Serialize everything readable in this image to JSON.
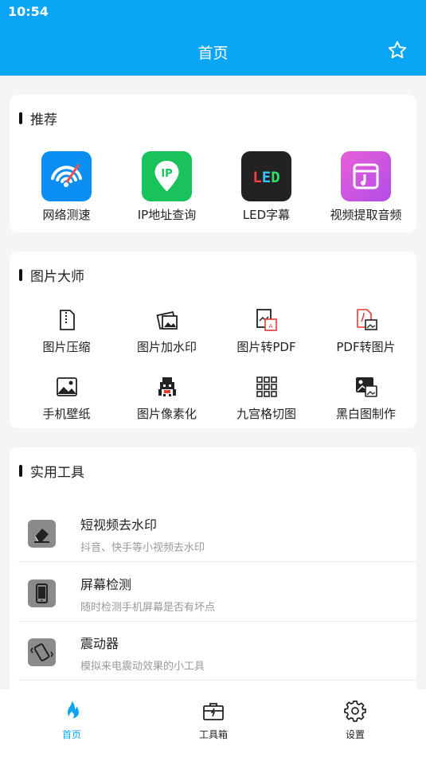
{
  "status": {
    "time": "10:54"
  },
  "header": {
    "title": "首页"
  },
  "recommend": {
    "title": "推荐",
    "items": [
      {
        "label": "网络测速",
        "icon": "speedometer-icon"
      },
      {
        "label": "IP地址查询",
        "icon": "ip-location-icon"
      },
      {
        "label": "LED字幕",
        "icon": "led-icon",
        "icon_text": "LED"
      },
      {
        "label": "视频提取音频",
        "icon": "video-audio-icon"
      }
    ]
  },
  "picture": {
    "title": "图片大师",
    "items": [
      {
        "label": "图片压缩",
        "icon": "zip-file-icon"
      },
      {
        "label": "图片加水印",
        "icon": "watermark-icon"
      },
      {
        "label": "图片转PDF",
        "icon": "image-to-pdf-icon"
      },
      {
        "label": "PDF转图片",
        "icon": "pdf-to-image-icon"
      },
      {
        "label": "手机壁纸",
        "icon": "wallpaper-icon"
      },
      {
        "label": "图片像素化",
        "icon": "pixelate-icon"
      },
      {
        "label": "九宫格切图",
        "icon": "grid-icon"
      },
      {
        "label": "黑白图制作",
        "icon": "black-white-icon"
      }
    ]
  },
  "tools": {
    "title": "实用工具",
    "items": [
      {
        "title": "短视频去水印",
        "desc": "抖音、快手等小视频去水印",
        "icon": "eraser-icon"
      },
      {
        "title": "屏幕检测",
        "desc": "随时检测手机屏幕是否有坏点",
        "icon": "phone-icon"
      },
      {
        "title": "震动器",
        "desc": "模拟来电震动效果的小工具",
        "icon": "vibrate-icon"
      }
    ]
  },
  "nav": {
    "items": [
      {
        "label": "首页",
        "icon": "fire-icon",
        "active": true
      },
      {
        "label": "工具箱",
        "icon": "toolbox-icon",
        "active": false
      },
      {
        "label": "设置",
        "icon": "gear-icon",
        "active": false
      }
    ]
  },
  "colors": {
    "primary": "#0aa6f5",
    "tool_icon_bg": "#8a8a8a"
  }
}
